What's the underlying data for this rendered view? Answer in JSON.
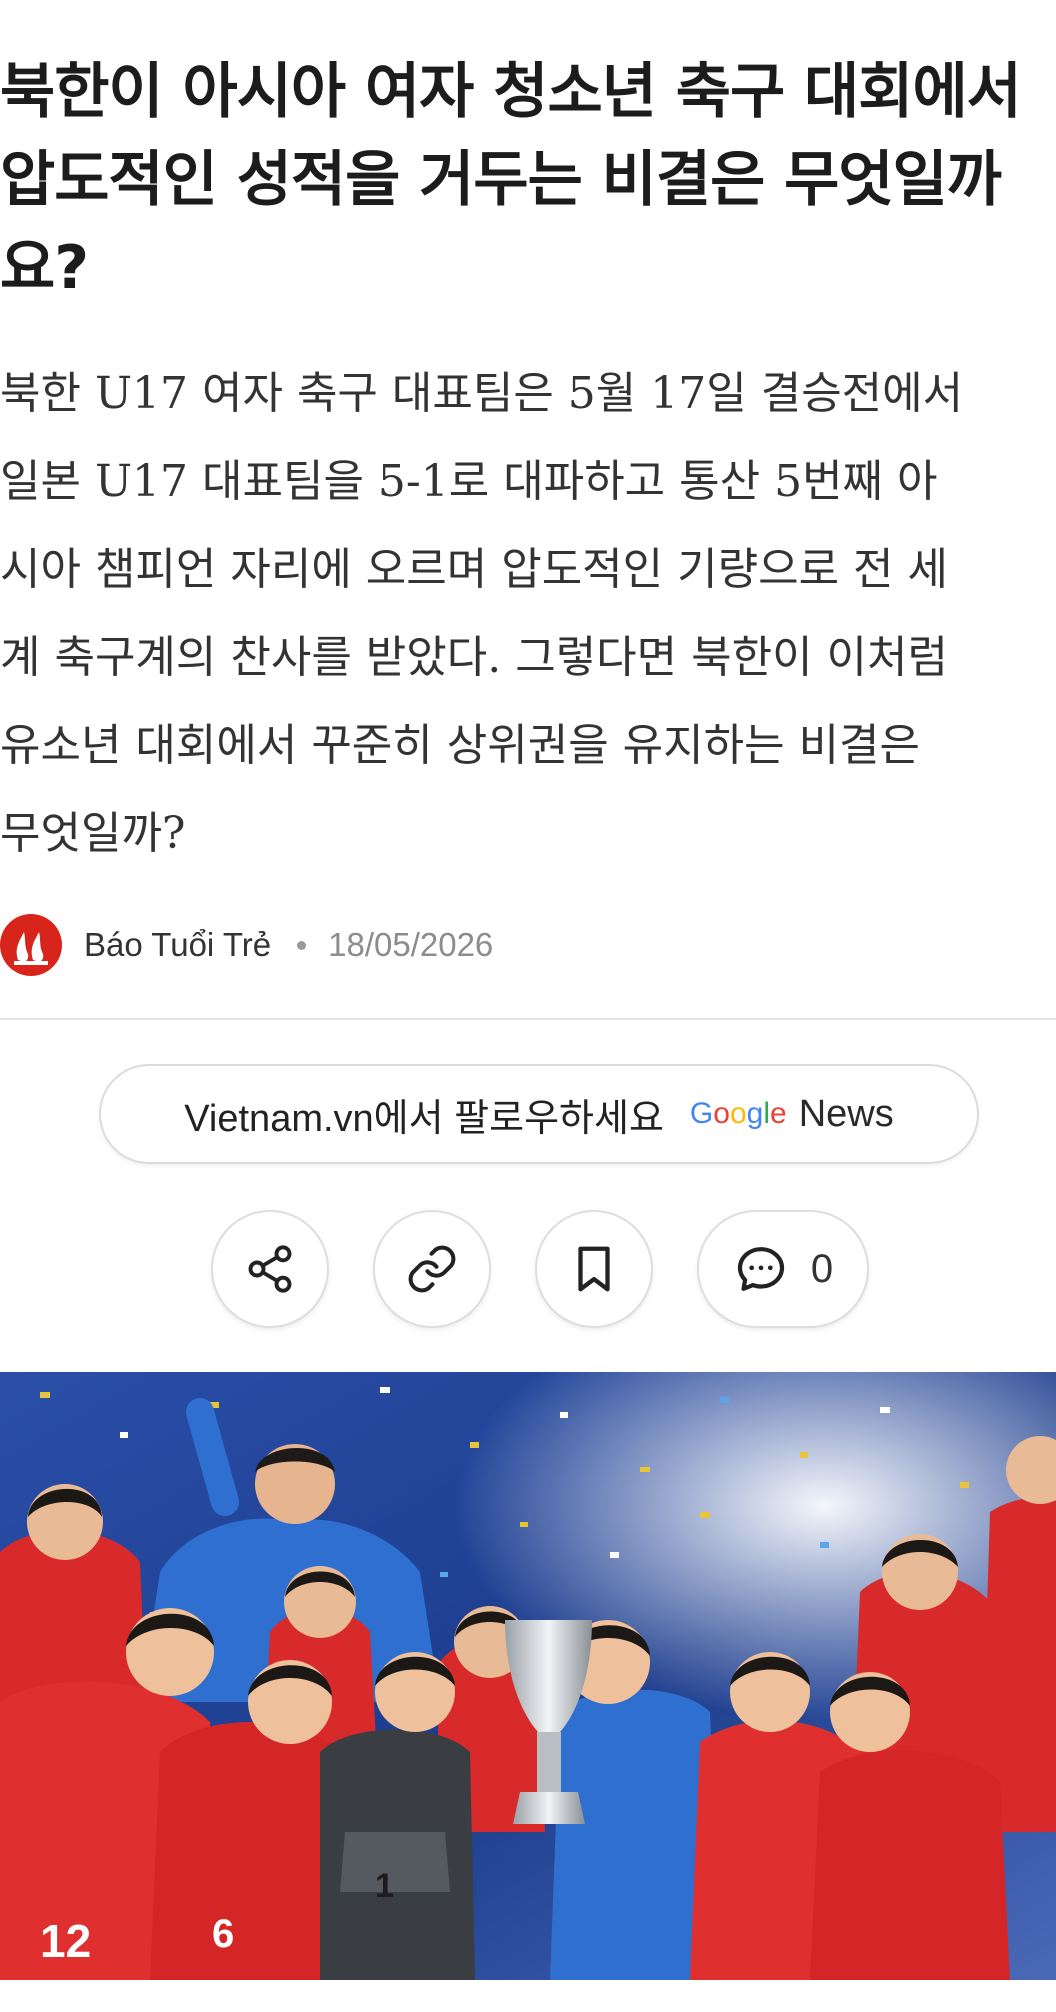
{
  "article": {
    "title": "북한이 아시아 여자 청소년 축구 대회에서\n압도적인 성적을 거두는 비결은 무엇일까\n요?",
    "lede": "북한 U17 여자 축구 대표팀은 5월 17일 결승전에서\n일본 U17 대표팀을 5-1로 대파하고 통산 5번째 아\n시아 챔피언 자리에 오르며 압도적인 기량으로 전 세\n계 축구계의 찬사를 받았다. 그렇다면 북한이 이처럼\n유소년 대회에서 꾸준히 상위권을 유지하는 비결은\n무엇일까?"
  },
  "meta": {
    "source": "Báo Tuổi Trẻ",
    "date": "18/05/2026",
    "logo_icon": "tuoi-tre-logo",
    "logo_color": "#d7251c"
  },
  "follow": {
    "label": "Vietnam.vn에서 팔로우하세요",
    "google_letters": [
      "G",
      "o",
      "o",
      "g",
      "l",
      "e"
    ],
    "google_colors": [
      "#4285F4",
      "#EA4335",
      "#FBBC05",
      "#4285F4",
      "#34A853",
      "#EA4335"
    ],
    "news": "News"
  },
  "actions": {
    "share_icon": "share-icon",
    "link_icon": "link-icon",
    "bookmark_icon": "bookmark-icon",
    "comment_icon": "comment-icon",
    "comment_count": "0"
  },
  "photo": {
    "description_icon": "team-celebration-photo",
    "jersey_numbers": [
      "12",
      "6",
      "1"
    ]
  }
}
